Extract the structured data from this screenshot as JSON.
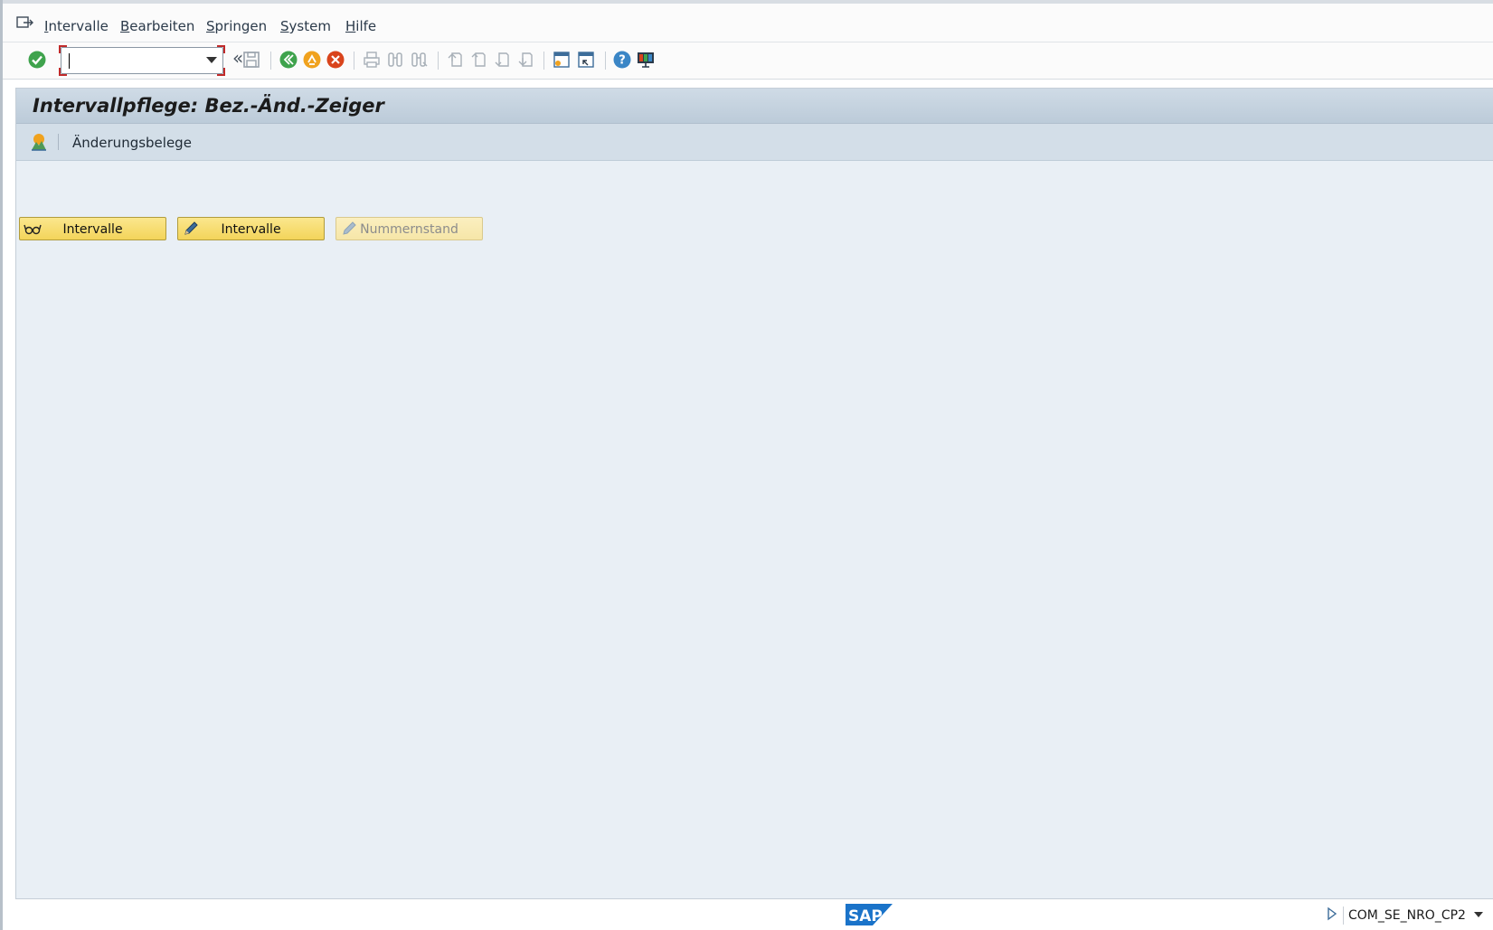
{
  "menu": {
    "items": [
      {
        "first": "I",
        "rest": "ntervalle"
      },
      {
        "first": "B",
        "rest": "earbeiten"
      },
      {
        "first": "S",
        "rest": "pringen"
      },
      {
        "first": "S",
        "rest": "ystem"
      },
      {
        "first": "H",
        "rest": "ilfe"
      }
    ]
  },
  "toolbar": {
    "command_value": "",
    "icons": [
      "enter-icon",
      "command-field",
      "back-double-icon",
      "save-icon",
      "back-icon",
      "exit-icon",
      "cancel-icon",
      "print-icon",
      "find-icon",
      "find-next-icon",
      "first-page-icon",
      "previous-page-icon",
      "next-page-icon",
      "last-page-icon",
      "new-session-icon",
      "create-shortcut-icon",
      "help-icon",
      "customize-layout-icon"
    ],
    "double_arrow": "«"
  },
  "page": {
    "title": "Intervallpflege: Bez.-Änd.-Zeiger",
    "appbar_label": "Änderungsbelege"
  },
  "buttons": {
    "display_intervals": "Intervalle",
    "change_intervals": "Intervalle",
    "number_status": "Nummernstand"
  },
  "status": {
    "system_info": "COM_SE_NRO_CP2",
    "logo_text": "SAP"
  },
  "colors": {
    "content_bg": "#e9eff5",
    "button_yellow": "#f3d45a",
    "title_bar": "#c6d4e1"
  }
}
